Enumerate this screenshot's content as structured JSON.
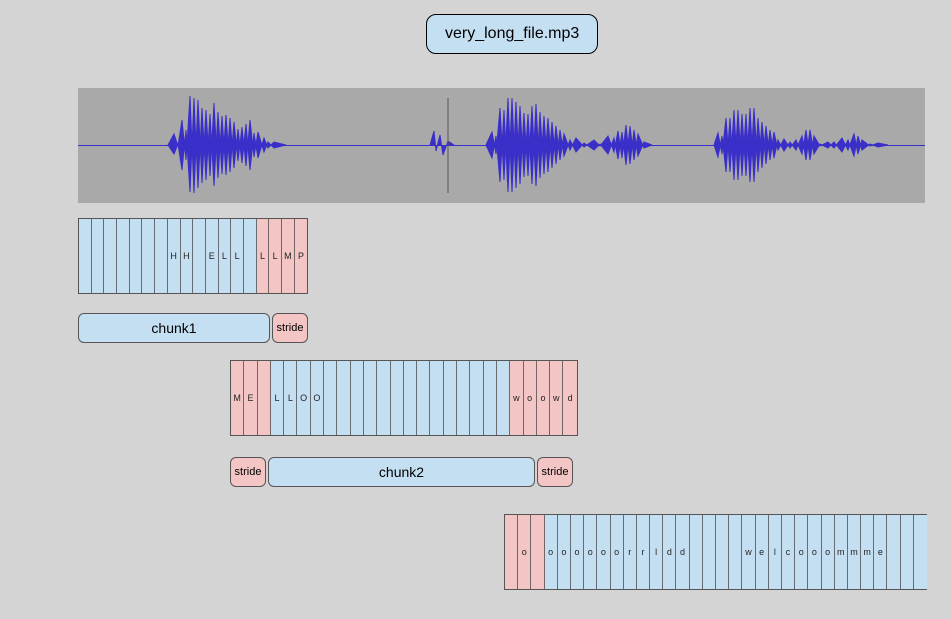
{
  "filename": "very_long_file.mp3",
  "chunk1": {
    "label": "chunk1",
    "stride_label": "stride",
    "tokens": [
      {
        "c": "",
        "s": "b"
      },
      {
        "c": "",
        "s": "b"
      },
      {
        "c": "",
        "s": "b"
      },
      {
        "c": "",
        "s": "b"
      },
      {
        "c": "",
        "s": "b"
      },
      {
        "c": "",
        "s": "b"
      },
      {
        "c": "",
        "s": "b"
      },
      {
        "c": "H",
        "s": "b"
      },
      {
        "c": "H",
        "s": "b"
      },
      {
        "c": "",
        "s": "b"
      },
      {
        "c": "E",
        "s": "b"
      },
      {
        "c": "L",
        "s": "b"
      },
      {
        "c": "L",
        "s": "b"
      },
      {
        "c": "",
        "s": "b"
      },
      {
        "c": "L",
        "s": "p"
      },
      {
        "c": "L",
        "s": "p"
      },
      {
        "c": "M",
        "s": "p"
      },
      {
        "c": "P",
        "s": "p"
      }
    ]
  },
  "chunk2": {
    "label": "chunk2",
    "stride_label": "stride",
    "tokens": [
      {
        "c": "M",
        "s": "p"
      },
      {
        "c": "E",
        "s": "p"
      },
      {
        "c": "",
        "s": "p"
      },
      {
        "c": "L",
        "s": "b"
      },
      {
        "c": "L",
        "s": "b"
      },
      {
        "c": "O",
        "s": "b"
      },
      {
        "c": "O",
        "s": "b"
      },
      {
        "c": "",
        "s": "b"
      },
      {
        "c": "",
        "s": "b"
      },
      {
        "c": "",
        "s": "b"
      },
      {
        "c": "",
        "s": "b"
      },
      {
        "c": "",
        "s": "b"
      },
      {
        "c": "",
        "s": "b"
      },
      {
        "c": "",
        "s": "b"
      },
      {
        "c": "",
        "s": "b"
      },
      {
        "c": "",
        "s": "b"
      },
      {
        "c": "",
        "s": "b"
      },
      {
        "c": "",
        "s": "b"
      },
      {
        "c": "",
        "s": "b"
      },
      {
        "c": "",
        "s": "b"
      },
      {
        "c": "",
        "s": "b"
      },
      {
        "c": "w",
        "s": "p"
      },
      {
        "c": "o",
        "s": "p"
      },
      {
        "c": "o",
        "s": "p"
      },
      {
        "c": "w",
        "s": "p"
      },
      {
        "c": "d",
        "s": "p"
      }
    ]
  },
  "chunk3": {
    "tokens": [
      {
        "c": "",
        "s": "p"
      },
      {
        "c": "o",
        "s": "p"
      },
      {
        "c": "",
        "s": "p"
      },
      {
        "c": "o",
        "s": "b"
      },
      {
        "c": "o",
        "s": "b"
      },
      {
        "c": "o",
        "s": "b"
      },
      {
        "c": "o",
        "s": "b"
      },
      {
        "c": "o",
        "s": "b"
      },
      {
        "c": "o",
        "s": "b"
      },
      {
        "c": "r",
        "s": "b"
      },
      {
        "c": "r",
        "s": "b"
      },
      {
        "c": "l",
        "s": "b"
      },
      {
        "c": "d",
        "s": "b"
      },
      {
        "c": "d",
        "s": "b"
      },
      {
        "c": "",
        "s": "b"
      },
      {
        "c": "",
        "s": "b"
      },
      {
        "c": "",
        "s": "b"
      },
      {
        "c": "",
        "s": "b"
      },
      {
        "c": "w",
        "s": "b"
      },
      {
        "c": "e",
        "s": "b"
      },
      {
        "c": "l",
        "s": "b"
      },
      {
        "c": "c",
        "s": "b"
      },
      {
        "c": "o",
        "s": "b"
      },
      {
        "c": "o",
        "s": "b"
      },
      {
        "c": "o",
        "s": "b"
      },
      {
        "c": "m",
        "s": "b"
      },
      {
        "c": "m",
        "s": "b"
      },
      {
        "c": "m",
        "s": "b"
      },
      {
        "c": "e",
        "s": "b"
      },
      {
        "c": "",
        "s": "b"
      },
      {
        "c": "",
        "s": "b"
      },
      {
        "c": "",
        "s": "b"
      }
    ]
  }
}
